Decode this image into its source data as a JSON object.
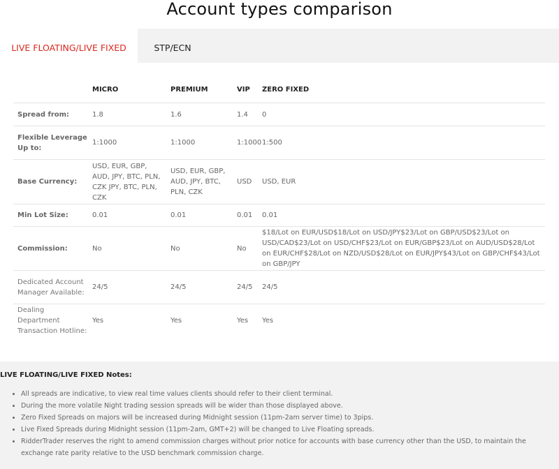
{
  "page": {
    "title": "Account types comparison"
  },
  "tabs": [
    {
      "label": "LIVE FLOATING/LIVE FIXED",
      "active": true
    },
    {
      "label": "STP/ECN",
      "active": false
    }
  ],
  "table": {
    "headers": [
      "",
      "MICRO",
      "PREMIUM",
      "VIP",
      "ZERO FIXED"
    ],
    "rows": [
      {
        "label": "Spread from:",
        "cells": [
          "1.8",
          "1.6",
          "1.4",
          "0"
        ]
      },
      {
        "label": "Flexible Leverage Up to:",
        "cells": [
          "1:1000",
          "1:1000",
          "1:1000",
          "1:500"
        ]
      },
      {
        "label": "Base Currency:",
        "cells": [
          "USD, EUR, GBP, AUD, JPY, BTC, PLN, CZK JPY, BTC, PLN, CZK",
          "USD, EUR, GBP, AUD, JPY, BTC, PLN, CZK",
          "USD",
          "USD, EUR"
        ]
      },
      {
        "label": "Min Lot Size:",
        "cells": [
          "0.01",
          "0.01",
          "0.01",
          "0.01"
        ]
      },
      {
        "label": "Commission:",
        "cells": [
          "No",
          "No",
          "No",
          "$18/Lot on EUR/USD$18/Lot on USD/JPY$23/Lot on GBP/USD$23/Lot on USD/CAD$23/Lot on USD/CHF$23/Lot on EUR/GBP$23/Lot on AUD/USD$28/Lot on EUR/CHF$28/Lot on NZD/USD$28/Lot on EUR/JPY$43/Lot on GBP/CHF$43/Lot on GBP/JPY"
        ]
      },
      {
        "label": "Dedicated Account Manager Available:",
        "cells": [
          "24/5",
          "24/5",
          "24/5",
          "24/5"
        ]
      },
      {
        "label": "Dealing Department Transaction Hotline:",
        "cells": [
          "Yes",
          "Yes",
          "Yes",
          "Yes"
        ]
      }
    ]
  },
  "notes": {
    "title": "LIVE FLOATING/LIVE FIXED Notes:",
    "items": [
      "All spreads are indicative, to view real time values clients should refer to their client terminal.",
      "During the more volatile Night trading session spreads will be wider than those displayed above.",
      "Zero Fixed Spreads on majors will be increased during Midnight session (11pm-2am server time) to 3pips.",
      "Live Fixed Spreads during Midnight session (11pm-2am, GMT+2) will be changed to Live Floating spreads.",
      "RidderTrader reserves the right to amend commission charges without prior notice for accounts with base currency other than the USD, to maintain the exchange rate parity relative to the USD benchmark commission charge."
    ]
  }
}
